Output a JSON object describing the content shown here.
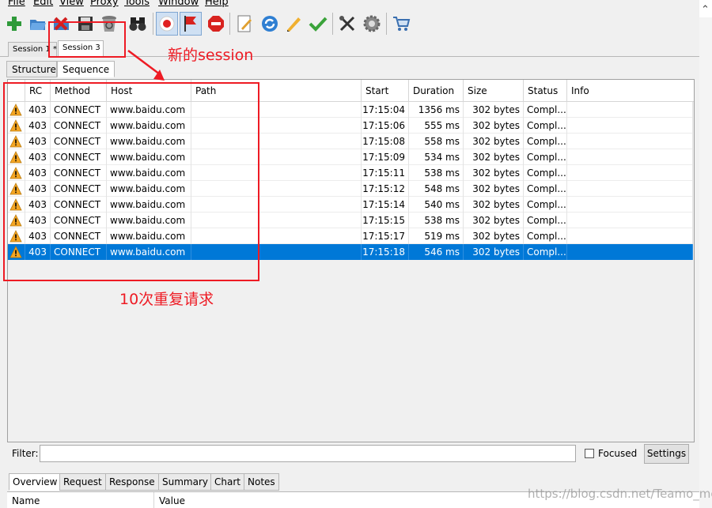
{
  "menu": [
    "File",
    "Edit",
    "View",
    "Proxy",
    "Tools",
    "Window",
    "Help"
  ],
  "toolbar": {
    "buttons": [
      {
        "name": "add-icon"
      },
      {
        "name": "open-folder-icon"
      },
      {
        "name": "close-session-icon"
      },
      {
        "name": "save-icon"
      },
      {
        "name": "trash-icon"
      },
      {
        "name": "binoculars-icon"
      },
      {
        "name": "record-icon"
      },
      {
        "name": "flag-icon"
      },
      {
        "name": "stop-icon"
      },
      {
        "name": "edit-icon"
      },
      {
        "name": "refresh-icon"
      },
      {
        "name": "pencil-icon"
      },
      {
        "name": "check-icon"
      },
      {
        "name": "tools-icon"
      },
      {
        "name": "gear-icon"
      },
      {
        "name": "shopping-cart-icon"
      }
    ]
  },
  "sessions": [
    {
      "label": "Session 1 *"
    },
    {
      "label": "Session 3"
    }
  ],
  "view_tabs": [
    "Structure",
    "Sequence"
  ],
  "table": {
    "columns": [
      "RC",
      "Method",
      "Host",
      "Path",
      "Start",
      "Duration",
      "Size",
      "Status",
      "Info"
    ],
    "rows": [
      {
        "rc": "403",
        "method": "CONNECT",
        "host": "www.baidu.com",
        "path": "",
        "start": "17:15:04",
        "duration": "1356 ms",
        "size": "302 bytes",
        "status": "Compl...",
        "info": ""
      },
      {
        "rc": "403",
        "method": "CONNECT",
        "host": "www.baidu.com",
        "path": "",
        "start": "17:15:06",
        "duration": "555 ms",
        "size": "302 bytes",
        "status": "Compl...",
        "info": ""
      },
      {
        "rc": "403",
        "method": "CONNECT",
        "host": "www.baidu.com",
        "path": "",
        "start": "17:15:08",
        "duration": "558 ms",
        "size": "302 bytes",
        "status": "Compl...",
        "info": ""
      },
      {
        "rc": "403",
        "method": "CONNECT",
        "host": "www.baidu.com",
        "path": "",
        "start": "17:15:09",
        "duration": "534 ms",
        "size": "302 bytes",
        "status": "Compl...",
        "info": ""
      },
      {
        "rc": "403",
        "method": "CONNECT",
        "host": "www.baidu.com",
        "path": "",
        "start": "17:15:11",
        "duration": "538 ms",
        "size": "302 bytes",
        "status": "Compl...",
        "info": ""
      },
      {
        "rc": "403",
        "method": "CONNECT",
        "host": "www.baidu.com",
        "path": "",
        "start": "17:15:12",
        "duration": "548 ms",
        "size": "302 bytes",
        "status": "Compl...",
        "info": ""
      },
      {
        "rc": "403",
        "method": "CONNECT",
        "host": "www.baidu.com",
        "path": "",
        "start": "17:15:14",
        "duration": "540 ms",
        "size": "302 bytes",
        "status": "Compl...",
        "info": ""
      },
      {
        "rc": "403",
        "method": "CONNECT",
        "host": "www.baidu.com",
        "path": "",
        "start": "17:15:15",
        "duration": "538 ms",
        "size": "302 bytes",
        "status": "Compl...",
        "info": ""
      },
      {
        "rc": "403",
        "method": "CONNECT",
        "host": "www.baidu.com",
        "path": "",
        "start": "17:15:17",
        "duration": "519 ms",
        "size": "302 bytes",
        "status": "Compl...",
        "info": ""
      },
      {
        "rc": "403",
        "method": "CONNECT",
        "host": "www.baidu.com",
        "path": "",
        "start": "17:15:18",
        "duration": "546 ms",
        "size": "302 bytes",
        "status": "Compl...",
        "info": "",
        "selected": true
      }
    ]
  },
  "filter": {
    "label": "Filter:",
    "value": "",
    "focused_label": "Focused",
    "settings_label": "Settings"
  },
  "bottom_tabs": [
    "Overview",
    "Request",
    "Response",
    "Summary",
    "Chart",
    "Notes"
  ],
  "bottom_table": {
    "columns": [
      "Name",
      "Value"
    ]
  },
  "annotations": {
    "new_session": "新的session",
    "repeat_requests": "10次重复请求"
  },
  "watermark": "https://blog.csdn.net/Teamo_mc",
  "colors": {
    "selection": "#0078d7",
    "annotation": "#ee1b24",
    "warning": "#f5a623"
  }
}
